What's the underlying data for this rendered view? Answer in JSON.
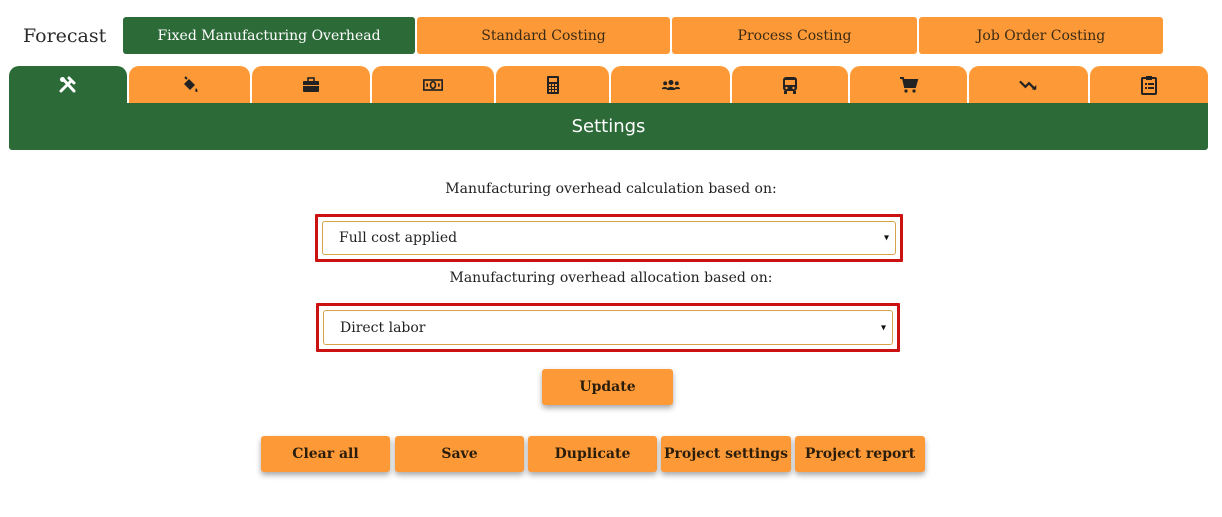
{
  "brand": "Forecast",
  "top_tabs": [
    {
      "label": "Fixed Manufacturing Overhead",
      "active": true
    },
    {
      "label": "Standard Costing",
      "active": false
    },
    {
      "label": "Process Costing",
      "active": false
    },
    {
      "label": "Job Order Costing",
      "active": false
    }
  ],
  "icon_tabs": [
    {
      "icon": "tools-icon",
      "active": true
    },
    {
      "icon": "paint-bucket-icon",
      "active": false
    },
    {
      "icon": "briefcase-icon",
      "active": false
    },
    {
      "icon": "money-icon",
      "active": false
    },
    {
      "icon": "calculator-icon",
      "active": false
    },
    {
      "icon": "users-icon",
      "active": false
    },
    {
      "icon": "bus-icon",
      "active": false
    },
    {
      "icon": "cart-icon",
      "active": false
    },
    {
      "icon": "trend-down-icon",
      "active": false
    },
    {
      "icon": "clipboard-icon",
      "active": false
    }
  ],
  "section_title": "Settings",
  "calc": {
    "label": "Manufacturing overhead calculation based on:",
    "value": "Full cost applied"
  },
  "alloc": {
    "label": "Manufacturing overhead allocation based on:",
    "value": "Direct labor"
  },
  "update_label": "Update",
  "actions": {
    "clear_all": "Clear all",
    "save": "Save",
    "duplicate": "Duplicate",
    "project_settings": "Project settings",
    "project_report": "Project report"
  },
  "colors": {
    "green": "#2c6a38",
    "orange": "#fd9a37",
    "highlight_red": "#cc1111"
  }
}
